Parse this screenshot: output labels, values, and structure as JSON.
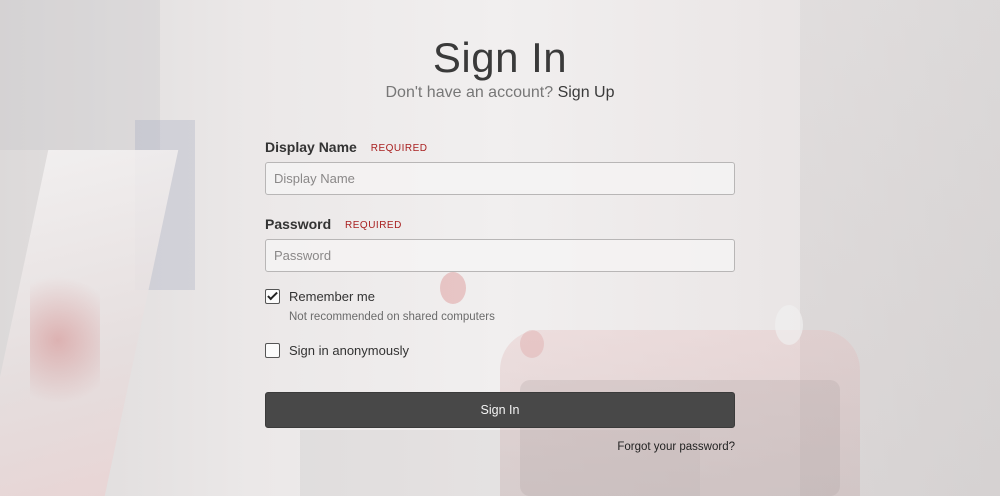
{
  "page": {
    "title": "Sign In",
    "subtitle_prefix": "Don't have an account?",
    "signup_link": "Sign Up"
  },
  "form": {
    "display_name": {
      "label": "Display Name",
      "required_tag": "REQUIRED",
      "placeholder": "Display Name",
      "value": ""
    },
    "password": {
      "label": "Password",
      "required_tag": "REQUIRED",
      "placeholder": "Password",
      "value": ""
    },
    "remember_me": {
      "label": "Remember me",
      "checked": true,
      "hint": "Not recommended on shared computers"
    },
    "anonymous": {
      "label": "Sign in anonymously",
      "checked": false
    },
    "submit_label": "Sign In",
    "forgot_link": "Forgot your password?"
  },
  "colors": {
    "button_bg": "#484848",
    "required": "#a81f1f",
    "text": "#333333"
  },
  "icons": {
    "checkbox_checked": "check-icon"
  }
}
